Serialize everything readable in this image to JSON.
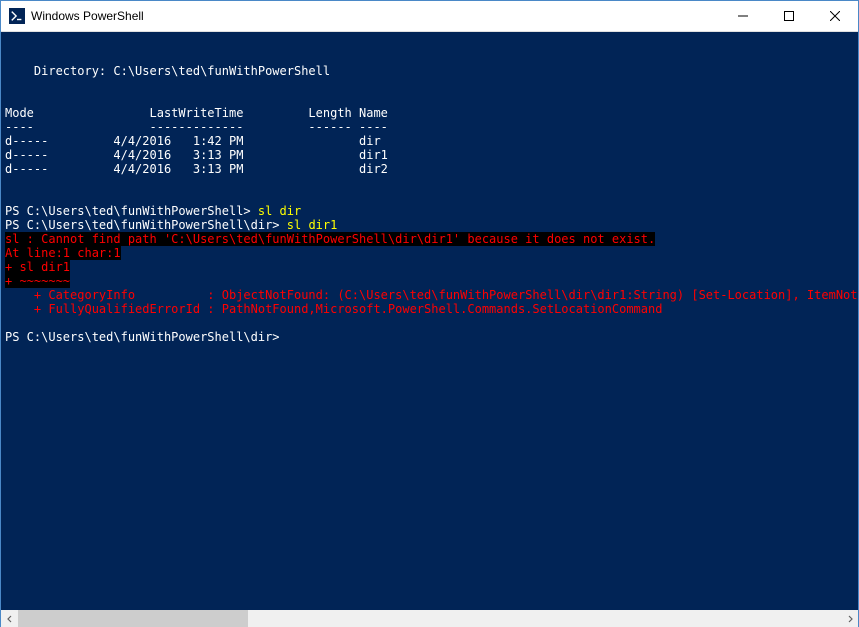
{
  "window": {
    "title": "Windows PowerShell"
  },
  "terminal": {
    "blank": "",
    "dirHeader": "    Directory: C:\\Users\\ted\\funWithPowerShell",
    "listHeader": "Mode                LastWriteTime         Length Name",
    "listHeaderUnder": "----                -------------         ------ ----",
    "row1": "d-----         4/4/2016   1:42 PM                dir",
    "row2": "d-----         4/4/2016   3:13 PM                dir1",
    "row3": "d-----         4/4/2016   3:13 PM                dir2",
    "prompt1Prefix": "PS C:\\Users\\ted\\funWithPowerShell> ",
    "prompt1Cmd": "sl dir",
    "prompt2Prefix": "PS C:\\Users\\ted\\funWithPowerShell\\dir> ",
    "prompt2Cmd": "sl dir1",
    "errMain": "sl : Cannot find path 'C:\\Users\\ted\\funWithPowerShell\\dir\\dir1' because it does not exist.",
    "errAtLine": "At line:1 char:1",
    "errCmdEcho": "+ sl dir1",
    "errUnderline": "+ ~~~~~~~",
    "errCategory": "    + CategoryInfo          : ObjectNotFound: (C:\\Users\\ted\\funWithPowerShell\\dir\\dir1:String) [Set-Location], ItemNotFo",
    "errFQID": "    + FullyQualifiedErrorId : PathNotFound,Microsoft.PowerShell.Commands.SetLocationCommand",
    "prompt3": "PS C:\\Users\\ted\\funWithPowerShell\\dir>"
  }
}
